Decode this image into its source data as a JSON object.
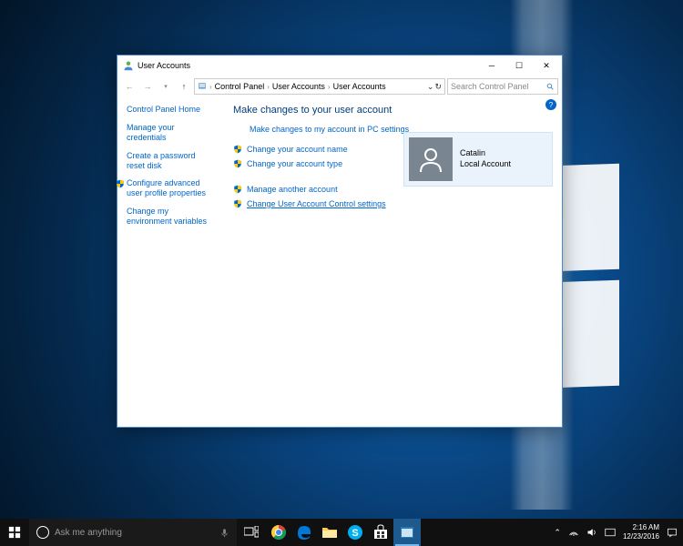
{
  "window": {
    "title": "User Accounts",
    "breadcrumb": [
      "Control Panel",
      "User Accounts",
      "User Accounts"
    ],
    "search_placeholder": "Search Control Panel"
  },
  "sidebar": {
    "home": "Control Panel Home",
    "items": [
      {
        "label": "Manage your credentials",
        "shield": false
      },
      {
        "label": "Create a password reset disk",
        "shield": false
      },
      {
        "label": "Configure advanced user profile properties",
        "shield": true
      },
      {
        "label": "Change my environment variables",
        "shield": false
      }
    ]
  },
  "main": {
    "heading": "Make changes to your user account",
    "pc_settings": "Make changes to my account in PC settings",
    "change_name": "Change your account name",
    "change_type": "Change your account type",
    "manage_another": "Manage another account",
    "uac_settings": "Change User Account Control settings"
  },
  "user": {
    "name": "Catalin",
    "type": "Local Account"
  },
  "taskbar": {
    "search_placeholder": "Ask me anything",
    "time": "2:16 AM",
    "date": "12/23/2016"
  }
}
